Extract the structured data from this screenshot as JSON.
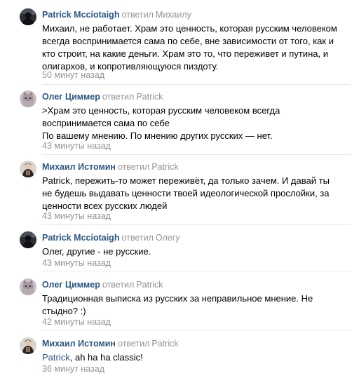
{
  "comments": [
    {
      "author": "Patrick Mcciotaigh",
      "verb": "ответил",
      "reply_to": "Михаилу",
      "avatar": "avatar-dark-figure",
      "lines": [
        "Михаил, не работает. Храм это ценность, которая русским человеком",
        "всегда воспринимается сама по себе, вне зависимости от того, как и",
        "кто строит, на какие деньги. Храм это то, что переживет и путина, и",
        "олигархов, и копротивляющуюся пиздоту."
      ],
      "time": "50 минут назад"
    },
    {
      "author": "Олег Циммер",
      "verb": "ответил",
      "reply_to": "Patrick",
      "avatar": "avatar-cat",
      "lines": [
        ">Храм это ценность, которая русским человеком всегда",
        "воспринимается сама по себе",
        "По вашему мнению. По мнению других русских — нет."
      ],
      "time": "43 минуты назад"
    },
    {
      "author": "Михаил Истомин",
      "verb": "ответил",
      "reply_to": "Patrick",
      "avatar": "avatar-costume-figure",
      "lines": [
        "Patrick, пережить-то может переживёт, да только зачем. И давай ты",
        "не будешь выдавать ценности твоей идеологической прослойки, за",
        "ценности всех русских людей"
      ],
      "mention": "Patrick",
      "time": "43 минуты назад"
    },
    {
      "author": "Patrick Mcciotaigh",
      "verb": "ответил",
      "reply_to": "Олегу",
      "avatar": "avatar-dark-figure",
      "lines": [
        "Олег, другие - не русские."
      ],
      "time": "43 минуты назад"
    },
    {
      "author": "Олег Циммер",
      "verb": "ответил",
      "reply_to": "Patrick",
      "avatar": "avatar-cat",
      "lines": [
        "Традиционная выписка из русских за неправильное мнение. Не",
        "стыдно? :)"
      ],
      "time": "42 минуты назад"
    },
    {
      "author": "Михаил Истомин",
      "verb": "ответил",
      "reply_to": "Patrick",
      "avatar": "avatar-costume-figure",
      "lines": [
        "Patrick, ah ha ha classic!"
      ],
      "mention": "Patrick",
      "time": "36 минут назад"
    }
  ],
  "colors": {
    "author_link": "#2a5885",
    "meta_gray": "#939393",
    "divider": "#e7e8ec",
    "text": "#000000"
  }
}
